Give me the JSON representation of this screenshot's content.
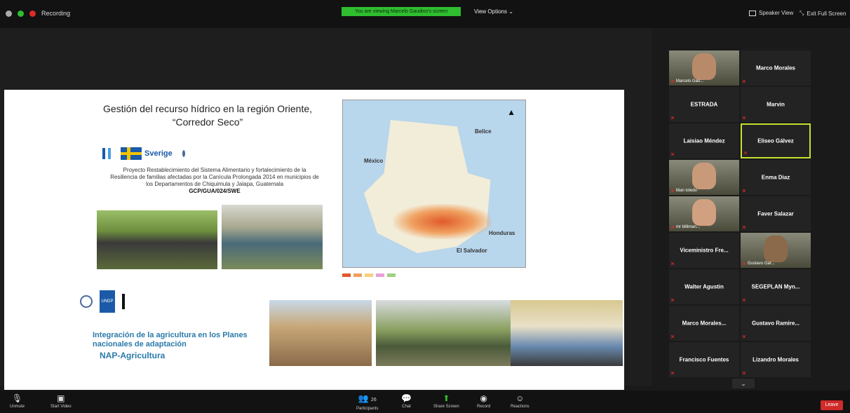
{
  "top_bar": {
    "recording_label": "Recording",
    "share_banner": "You are viewing Marcelo Gaudino's screen",
    "view_options": "View Options",
    "speaker_view": "Speaker View",
    "exit_full_screen": "Exit Full Screen"
  },
  "slide": {
    "title_line1": "Gestión del recurso hídrico en la región Oriente,",
    "title_line2": "“Corredor Seco”",
    "sweden_logo_text": "Sverige",
    "project_text": "Proyecto Restablecimiento del Sistema Alimentario y fortalecimiento de la Resiliencia de familias afectadas por la Canícula Prolongada 2014 en municipios de los Departamentos de Chiquimula y Jalapa, Guatemala",
    "project_code": "GCP/GUA/024/SWE",
    "map_labels": {
      "belice": "Belice",
      "mexico": "México",
      "honduras": "Honduras",
      "el_salvador": "El Salvador"
    },
    "nap_title": "Integración de la agricultura en los Planes nacionales de adaptación",
    "nap_subtitle": "NAP-Agricultura"
  },
  "participants": [
    {
      "name": "Marcelo Gau...",
      "display": "",
      "has_video": true,
      "muted": true
    },
    {
      "name": "",
      "display": "Marco Morales",
      "has_video": false,
      "muted": true
    },
    {
      "name": "",
      "display": "ESTRADA",
      "has_video": false,
      "muted": true
    },
    {
      "name": "",
      "display": "Marvin",
      "has_video": false,
      "muted": true
    },
    {
      "name": "",
      "display": "Laisiao Méndez",
      "has_video": false,
      "muted": true
    },
    {
      "name": "",
      "display": "Eliseo Gálvez",
      "has_video": false,
      "muted": true,
      "active": true
    },
    {
      "name": "lilian toledo",
      "display": "",
      "has_video": true,
      "muted": true
    },
    {
      "name": "",
      "display": "Enma Diaz",
      "has_video": false,
      "muted": true
    },
    {
      "name": "mr billiman...",
      "display": "",
      "has_video": true,
      "muted": true
    },
    {
      "name": "",
      "display": "Faver Salazar",
      "has_video": false,
      "muted": true
    },
    {
      "name": "",
      "display": "Viceministro Fre...",
      "has_video": false,
      "muted": true
    },
    {
      "name": "Gustavo Gar...",
      "display": "",
      "has_video": true,
      "muted": true
    },
    {
      "name": "",
      "display": "Walter Agustin",
      "has_video": false,
      "muted": true
    },
    {
      "name": "",
      "display": "SEGEPLAN Myn...",
      "has_video": false,
      "muted": true
    },
    {
      "name": "",
      "display": "Marco Morales...",
      "has_video": false,
      "muted": true
    },
    {
      "name": "",
      "display": "Gustavo Ramire...",
      "has_video": false,
      "muted": true
    },
    {
      "name": "",
      "display": "Francisco Fuentes",
      "has_video": false,
      "muted": true
    },
    {
      "name": "",
      "display": "Lizandro Morales",
      "has_video": false,
      "muted": true
    }
  ],
  "toolbar": {
    "unmute": "Unmute",
    "start_video": "Start Video",
    "participants": "Participants",
    "participants_count": "26",
    "chat": "Chat",
    "share_screen": "Share Screen",
    "record": "Record",
    "reactions": "Reactions",
    "leave": "Leave"
  },
  "colors": {
    "share_banner": "#2fbe2f",
    "active_speaker_border": "#c8e030",
    "leave_button": "#d02a2a",
    "muted_icon": "#e02a2a"
  }
}
